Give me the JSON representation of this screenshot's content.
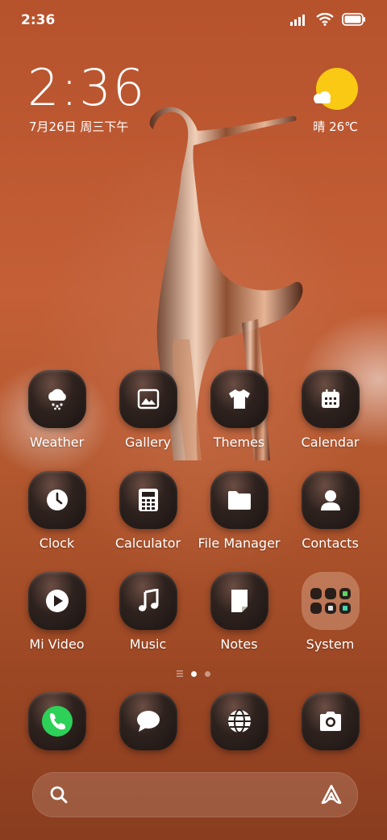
{
  "status_bar": {
    "time": "2:36"
  },
  "clock_widget": {
    "time": "2:36",
    "date": "7月26日 周三下午"
  },
  "weather_widget": {
    "text": "晴 26℃",
    "icon": "sunny-cloud-icon"
  },
  "apps": [
    {
      "label": "Weather",
      "icon": "weather-snow-icon"
    },
    {
      "label": "Gallery",
      "icon": "gallery-icon"
    },
    {
      "label": "Themes",
      "icon": "tshirt-icon"
    },
    {
      "label": "Calendar",
      "icon": "calendar-icon"
    },
    {
      "label": "Clock",
      "icon": "clock-icon"
    },
    {
      "label": "Calculator",
      "icon": "calculator-icon"
    },
    {
      "label": "File Manager",
      "icon": "folder-icon"
    },
    {
      "label": "Contacts",
      "icon": "person-icon"
    },
    {
      "label": "Mi Video",
      "icon": "play-icon"
    },
    {
      "label": "Music",
      "icon": "music-note-icon"
    },
    {
      "label": "Notes",
      "icon": "note-icon"
    },
    {
      "label": "System",
      "icon": "folder-grid-icon"
    }
  ],
  "dock": [
    {
      "name": "phone",
      "icon": "phone-icon",
      "color": "#2ed158"
    },
    {
      "name": "messages",
      "icon": "message-icon"
    },
    {
      "name": "browser",
      "icon": "globe-icon"
    },
    {
      "name": "camera",
      "icon": "camera-icon"
    }
  ],
  "page_indicator": {
    "pages": 2,
    "current": 1
  },
  "colors": {
    "sun": "#f9c914",
    "phone_green": "#2ed158"
  }
}
